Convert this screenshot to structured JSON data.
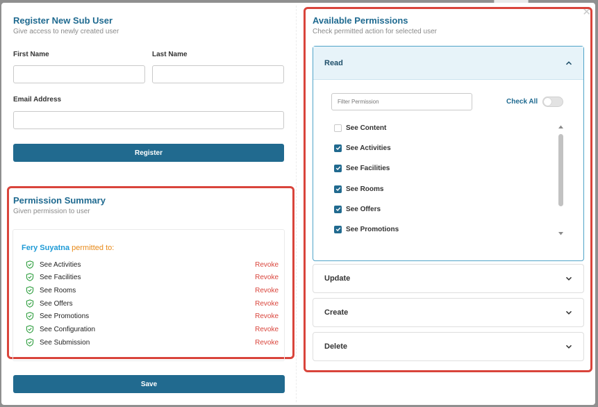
{
  "register": {
    "title": "Register New Sub User",
    "subtitle": "Give access to newly created user",
    "first_name_label": "First Name",
    "last_name_label": "Last Name",
    "email_label": "Email Address",
    "first_name_value": "",
    "last_name_value": "",
    "email_value": "",
    "register_button": "Register"
  },
  "summary": {
    "title": "Permission Summary",
    "subtitle": "Given permission to user",
    "user_name": "Fery Suyatna",
    "permitted_text": "permitted to:",
    "revoke_label": "Revoke",
    "items": [
      "See Activities",
      "See Facilities",
      "See Rooms",
      "See Offers",
      "See Promotions",
      "See Configuration",
      "See Submission"
    ],
    "save_button": "Save"
  },
  "permissions": {
    "title": "Available Permissions",
    "subtitle": "Check permitted action for selected user",
    "read_label": "Read",
    "filter_placeholder": "Filter Permission",
    "check_all_label": "Check All",
    "check_all_on": false,
    "read_items": [
      {
        "label": "See Content",
        "checked": false
      },
      {
        "label": "See Activities",
        "checked": true
      },
      {
        "label": "See Facilities",
        "checked": true
      },
      {
        "label": "See Rooms",
        "checked": true
      },
      {
        "label": "See Offers",
        "checked": true
      },
      {
        "label": "See Promotions",
        "checked": true
      }
    ],
    "update_label": "Update",
    "create_label": "Create",
    "delete_label": "Delete"
  },
  "colors": {
    "primary": "#216a8f",
    "highlight_border": "#d9443b",
    "revoke": "#d9443b",
    "user_name": "#1e9ad6",
    "permitted_text": "#e88a1a",
    "shield": "#2e9e3e"
  },
  "icons": {
    "close": "close-icon",
    "shield": "shield-check-icon",
    "chevron_up": "chevron-up-icon",
    "chevron_down": "chevron-down-icon",
    "check": "checkmark-icon"
  }
}
